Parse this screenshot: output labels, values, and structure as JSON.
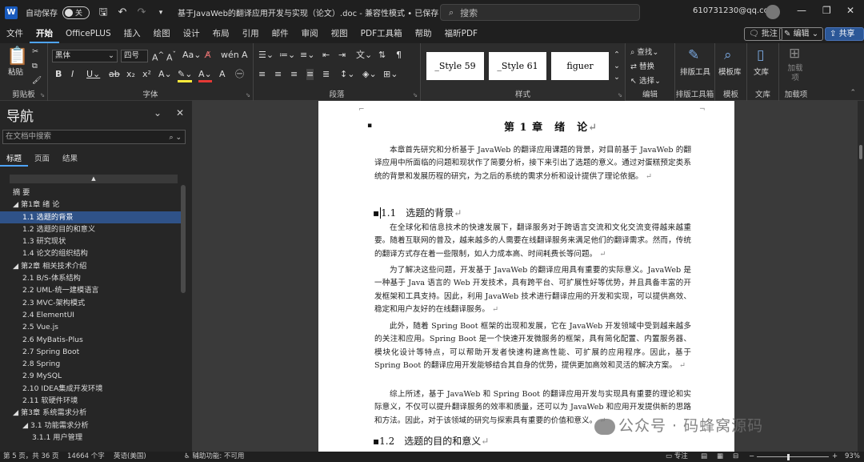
{
  "titlebar": {
    "app_icon": "W",
    "autosave_label": "自动保存",
    "autosave_state": "关",
    "doc_title": "基于JavaWeb的翻译应用开发与实现（论文）.doc  -  兼容性模式 • 已保存 ⌄",
    "search_placeholder": "搜索",
    "account": "610731230@qq.com"
  },
  "menu": {
    "items": [
      "文件",
      "开始",
      "OfficePLUS",
      "插入",
      "绘图",
      "设计",
      "布局",
      "引用",
      "邮件",
      "审阅",
      "视图",
      "PDF工具箱",
      "帮助",
      "福昕PDF"
    ],
    "active": "开始",
    "comment_btn": "批注",
    "edit_btn": "编辑 ⌄",
    "share_btn": "共享 ⌄"
  },
  "ribbon": {
    "clipboard_label": "剪贴板",
    "paste_label": "粘贴",
    "font_label": "字体",
    "font_name": "黑体",
    "font_size": "四号",
    "paragraph_label": "段落",
    "styles_label": "样式",
    "styles": [
      "_Style 59",
      "_Style 61",
      "figuer"
    ],
    "edit_label": "编辑",
    "find": "查找",
    "replace": "替换",
    "select": "选择",
    "layout_tool": "排版工具",
    "layout_tool_group": "排版工具箱",
    "template_lib": "模板库",
    "template_group": "模板",
    "library": "文库",
    "library_group": "文库",
    "addin": "加载项",
    "addin_group": "加载项"
  },
  "nav": {
    "title": "导航",
    "search_placeholder": "在文档中搜索",
    "tabs": [
      "标题",
      "页面",
      "结果"
    ],
    "items": [
      {
        "text": "摘  要",
        "indent": 0
      },
      {
        "text": "◢ 第1章 绪 论",
        "indent": 0
      },
      {
        "text": "1.1  选题的背景",
        "indent": 1,
        "selected": true
      },
      {
        "text": "1.2  选题的目的和意义",
        "indent": 1
      },
      {
        "text": "1.3  研究现状",
        "indent": 1
      },
      {
        "text": "1.4  论文的组织结构",
        "indent": 1
      },
      {
        "text": "◢ 第2章  相关技术介绍",
        "indent": 0
      },
      {
        "text": "2.1  B/S-体系结构",
        "indent": 1
      },
      {
        "text": "2.2  UML-统一建模语言",
        "indent": 1
      },
      {
        "text": "2.3  MVC-架构模式",
        "indent": 1
      },
      {
        "text": "2.4  ElementUI",
        "indent": 1
      },
      {
        "text": "2.5  Vue.js",
        "indent": 1
      },
      {
        "text": "2.6  MyBatis-Plus",
        "indent": 1
      },
      {
        "text": "2.7  Spring Boot",
        "indent": 1
      },
      {
        "text": "2.8   Spring",
        "indent": 1
      },
      {
        "text": "2.9  MySQL",
        "indent": 1
      },
      {
        "text": "2.10  IDEA集成开发环境",
        "indent": 1
      },
      {
        "text": "2.11  软硬件环境",
        "indent": 1
      },
      {
        "text": "◢ 第3章  系统需求分析",
        "indent": 0
      },
      {
        "text": "◢ 3.1  功能需求分析",
        "indent": 1
      },
      {
        "text": "3.1.1  用户管理",
        "indent": 2
      }
    ]
  },
  "document": {
    "chapter_title": "第 1 章　绪　论",
    "intro": "本章首先研究和分析基于 JavaWeb 的翻译应用课题的背景，对目前基于 JavaWeb 的翻译应用中所面临的问题和现状作了简要分析，接下来引出了选题的意义。通过对蛋糕预定类系统的背景和发展历程的研究，为之后的系统的需求分析和设计提供了理论依据。",
    "h1_1": "1.1　选题的背景",
    "p1": "在全球化和信息技术的快速发展下，翻译服务对于跨语言交流和文化交流变得越来越重要。随着互联网的普及，越来越多的人需要在线翻译服务来满足他们的翻译需求。然而，传统的翻译方式存在着一些限制，如人力成本高、时间耗费长等问题。",
    "p2": "为了解决这些问题，开发基于 JavaWeb 的翻译应用具有重要的实际意义。JavaWeb 是一种基于 Java 语言的 Web 开发技术，具有跨平台、可扩展性好等优势，并且具备丰富的开发框架和工具支持。因此，利用 JavaWeb 技术进行翻译应用的开发和实现，可以提供高效、稳定和用户友好的在线翻译服务。",
    "p3": "此外，随着 Spring Boot 框架的出现和发展，它在 JavaWeb 开发领域中受到越来越多的关注和应用。Spring Boot 是一个快速开发微服务的框架，具有简化配置、内置服务器、模块化设计等特点，可以帮助开发者快速构建高性能、可扩展的应用程序。因此，基于 Spring Boot 的翻译应用开发能够结合其自身的优势，提供更加高效和灵活的解决方案。",
    "p4": "综上所述，基于 JavaWeb 和 Spring Boot 的翻译应用开发与实现具有重要的理论和实际意义，不仅可以提升翻译服务的效率和质量，还可以为 JavaWeb 和应用开发提供新的思路和方法。因此，对于该领域的研究与探索具有重要的价值和意义。",
    "h1_2": "1.2　选题的目的和意义"
  },
  "status": {
    "page": "第 5 页，共 36 页",
    "words": "14664 个字",
    "lang": "英语(美国)",
    "accessibility": "辅助功能: 不可用",
    "focus": "专注",
    "zoom": "93%"
  },
  "watermark": "公众号 · 码蜂窝源码"
}
